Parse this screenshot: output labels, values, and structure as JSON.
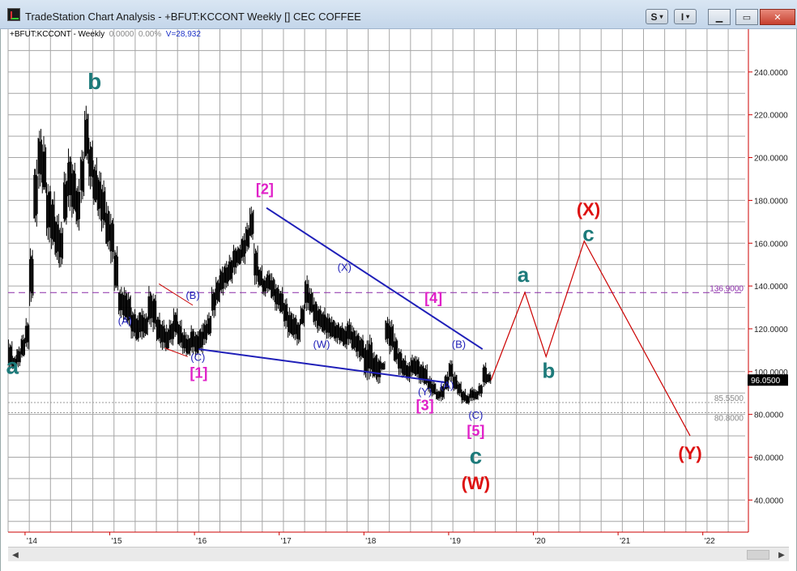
{
  "window": {
    "title": "TradeStation Chart Analysis - +BFUT:KCCONT Weekly [] CEC COFFEE",
    "toolbar_s_label": "S",
    "toolbar_i_label": "I"
  },
  "info": {
    "symbol": "+BFUT:KCCONT - Weekly",
    "change": "0.0000",
    "change_pct": "0.00%",
    "volume": "V=28,932"
  },
  "colors": {
    "grid": "#a6a6a6",
    "price": "#000000",
    "axis": "#cc0000",
    "trendline": "#1f1fb8",
    "projection": "#cc0000",
    "level": "#8a2aa8",
    "teal": "#1d7a7a",
    "magenta": "#e020c8",
    "blue_label": "#1f1fb8",
    "red_label": "#dd1111"
  },
  "chart_data": {
    "type": "line",
    "title": "",
    "xlabel": "",
    "ylabel": "",
    "ylim": [
      25,
      260
    ],
    "yticks": [
      "240.0000",
      "220.0000",
      "200.0000",
      "180.0000",
      "160.0000",
      "140.0000",
      "120.0000",
      "100.0000",
      "80.0000",
      "60.0000",
      "40.0000"
    ],
    "ytick_values": [
      240,
      220,
      200,
      180,
      160,
      140,
      120,
      100,
      80,
      60,
      40
    ],
    "xticks": [
      "'14",
      "'15",
      "'16",
      "'17",
      "'18",
      "'19",
      "'20",
      "'21",
      "'22"
    ],
    "xtick_values": [
      2014.0,
      2015.0,
      2016.0,
      2017.0,
      2018.0,
      2019.0,
      2020.0,
      2021.0,
      2022.0
    ],
    "xlim": [
      2013.8,
      2022.5
    ],
    "last_price": "96.0500",
    "last_price_value": 96.05,
    "levels": [
      {
        "label": "136.9000",
        "value": 136.9,
        "style": "dashed"
      },
      {
        "label": "85.5500",
        "value": 85.55,
        "style": "dotted"
      },
      {
        "label": "80.8000",
        "value": 80.8,
        "style": "dotted"
      }
    ],
    "series": [
      {
        "type": "price",
        "x": [
          2013.8,
          2013.85,
          2013.9,
          2013.95,
          2014.0,
          2014.05,
          2014.1,
          2014.15,
          2014.2,
          2014.25,
          2014.3,
          2014.35,
          2014.4,
          2014.45,
          2014.5,
          2014.55,
          2014.6,
          2014.65,
          2014.7,
          2014.75,
          2014.8,
          2014.85,
          2014.9,
          2014.95,
          2015.0,
          2015.05,
          2015.1,
          2015.15,
          2015.2,
          2015.25,
          2015.3,
          2015.35,
          2015.4,
          2015.45,
          2015.5,
          2015.55,
          2015.6,
          2015.65,
          2015.7,
          2015.75,
          2015.8,
          2015.85,
          2015.9,
          2015.95,
          2016.0,
          2016.05,
          2016.1,
          2016.15,
          2016.2,
          2016.25,
          2016.3,
          2016.35,
          2016.4,
          2016.45,
          2016.5,
          2016.55,
          2016.6,
          2016.65,
          2016.7,
          2016.75,
          2016.8,
          2016.85,
          2016.9,
          2016.95,
          2017.0,
          2017.05,
          2017.1,
          2017.15,
          2017.2,
          2017.25,
          2017.3,
          2017.35,
          2017.4,
          2017.45,
          2017.5,
          2017.55,
          2017.6,
          2017.65,
          2017.7,
          2017.75,
          2017.8,
          2017.85,
          2017.9,
          2017.95,
          2018.0,
          2018.05,
          2018.1,
          2018.15,
          2018.2,
          2018.25,
          2018.3,
          2018.35,
          2018.4,
          2018.45,
          2018.5,
          2018.55,
          2018.6,
          2018.65,
          2018.7,
          2018.75,
          2018.8,
          2018.85,
          2018.9,
          2018.95,
          2019.0,
          2019.05,
          2019.1,
          2019.15,
          2019.2,
          2019.25,
          2019.3,
          2019.35,
          2019.4,
          2019.45
        ],
        "high": [
          115,
          108,
          112,
          118,
          125,
          160,
          200,
          215,
          210,
          190,
          185,
          175,
          170,
          195,
          205,
          200,
          190,
          205,
          225,
          210,
          200,
          195,
          190,
          180,
          175,
          160,
          140,
          140,
          138,
          130,
          128,
          130,
          128,
          140,
          138,
          128,
          125,
          122,
          125,
          130,
          125,
          120,
          118,
          122,
          120,
          122,
          125,
          128,
          140,
          145,
          150,
          152,
          155,
          160,
          160,
          165,
          170,
          178,
          160,
          150,
          145,
          148,
          146,
          142,
          140,
          135,
          130,
          128,
          125,
          132,
          145,
          140,
          135,
          132,
          130,
          128,
          126,
          124,
          123,
          122,
          125,
          122,
          120,
          118,
          115,
          118,
          110,
          108,
          105,
          126,
          125,
          118,
          112,
          108,
          105,
          108,
          108,
          105,
          104,
          98,
          96,
          92,
          95,
          100,
          106,
          100,
          96,
          92,
          90,
          93,
          92,
          95,
          105,
          100
        ],
        "low": [
          100,
          100,
          102,
          105,
          110,
          130,
          165,
          185,
          180,
          160,
          155,
          150,
          148,
          165,
          175,
          170,
          165,
          178,
          195,
          185,
          175,
          170,
          165,
          155,
          150,
          135,
          125,
          122,
          120,
          115,
          112,
          115,
          115,
          120,
          118,
          112,
          110,
          108,
          112,
          115,
          110,
          108,
          106,
          108,
          106,
          108,
          112,
          115,
          125,
          130,
          135,
          138,
          140,
          145,
          148,
          150,
          155,
          160,
          140,
          138,
          135,
          136,
          132,
          128,
          125,
          120,
          115,
          114,
          112,
          120,
          128,
          125,
          120,
          118,
          116,
          115,
          114,
          113,
          112,
          110,
          112,
          108,
          106,
          104,
          95,
          96,
          95,
          94,
          100,
          112,
          108,
          102,
          98,
          96,
          95,
          97,
          96,
          94,
          92,
          90,
          88,
          86,
          86,
          90,
          95,
          90,
          88,
          85,
          84,
          86,
          86,
          88,
          92,
          94
        ]
      },
      {
        "type": "trendline",
        "x": [
          2016.05,
          2018.95
        ],
        "y": [
          110.5,
          95.0
        ]
      },
      {
        "type": "trendline",
        "x": [
          2016.85,
          2019.4
        ],
        "y": [
          176.5,
          110.5
        ]
      },
      {
        "type": "projection",
        "x": [
          2019.5,
          2019.9,
          2020.15,
          2020.6,
          2021.85
        ],
        "y": [
          96,
          137,
          107,
          161,
          70
        ]
      }
    ],
    "annotations": [
      {
        "text": "b",
        "color": "teal",
        "x": 2014.82,
        "y": 232,
        "size": 28
      },
      {
        "text": "a",
        "color": "teal",
        "x": 2013.85,
        "y": 99,
        "size": 28
      },
      {
        "text": "[2]",
        "color": "magenta",
        "x": 2016.83,
        "y": 183,
        "size": 18
      },
      {
        "text": "(A)",
        "color": "blue_label",
        "x": 2015.18,
        "y": 122,
        "size": 13
      },
      {
        "text": "(B)",
        "color": "blue_label",
        "x": 2015.98,
        "y": 134,
        "size": 13
      },
      {
        "text": "(C)",
        "color": "blue_label",
        "x": 2016.04,
        "y": 105,
        "size": 13
      },
      {
        "text": "[1]",
        "color": "magenta",
        "x": 2016.05,
        "y": 97,
        "size": 18
      },
      {
        "text": "(X)",
        "color": "blue_label",
        "x": 2017.77,
        "y": 147,
        "size": 13
      },
      {
        "text": "(W)",
        "color": "blue_label",
        "x": 2017.5,
        "y": 111,
        "size": 13
      },
      {
        "text": "[4]",
        "color": "magenta",
        "x": 2018.82,
        "y": 132,
        "size": 18
      },
      {
        "text": "(B)",
        "color": "blue_label",
        "x": 2019.12,
        "y": 111,
        "size": 13
      },
      {
        "text": "(Y)",
        "color": "blue_label",
        "x": 2018.72,
        "y": 89,
        "size": 13
      },
      {
        "text": "(A)",
        "color": "blue_label",
        "x": 2018.98,
        "y": 92,
        "size": 13
      },
      {
        "text": "[3]",
        "color": "magenta",
        "x": 2018.72,
        "y": 82,
        "size": 18
      },
      {
        "text": "(C)",
        "color": "blue_label",
        "x": 2019.32,
        "y": 78,
        "size": 13
      },
      {
        "text": "[5]",
        "color": "magenta",
        "x": 2019.32,
        "y": 70,
        "size": 18
      },
      {
        "text": "c",
        "color": "teal",
        "x": 2019.32,
        "y": 57,
        "size": 28
      },
      {
        "text": "(W)",
        "color": "red_label",
        "x": 2019.32,
        "y": 45,
        "size": 22
      },
      {
        "text": "a",
        "color": "teal",
        "x": 2019.88,
        "y": 142,
        "size": 26
      },
      {
        "text": "b",
        "color": "teal",
        "x": 2020.18,
        "y": 97,
        "size": 26
      },
      {
        "text": "(X)",
        "color": "red_label",
        "x": 2020.65,
        "y": 173,
        "size": 22
      },
      {
        "text": "c",
        "color": "teal",
        "x": 2020.65,
        "y": 161,
        "size": 26
      },
      {
        "text": "(Y)",
        "color": "red_label",
        "x": 2021.85,
        "y": 59,
        "size": 22
      }
    ]
  }
}
